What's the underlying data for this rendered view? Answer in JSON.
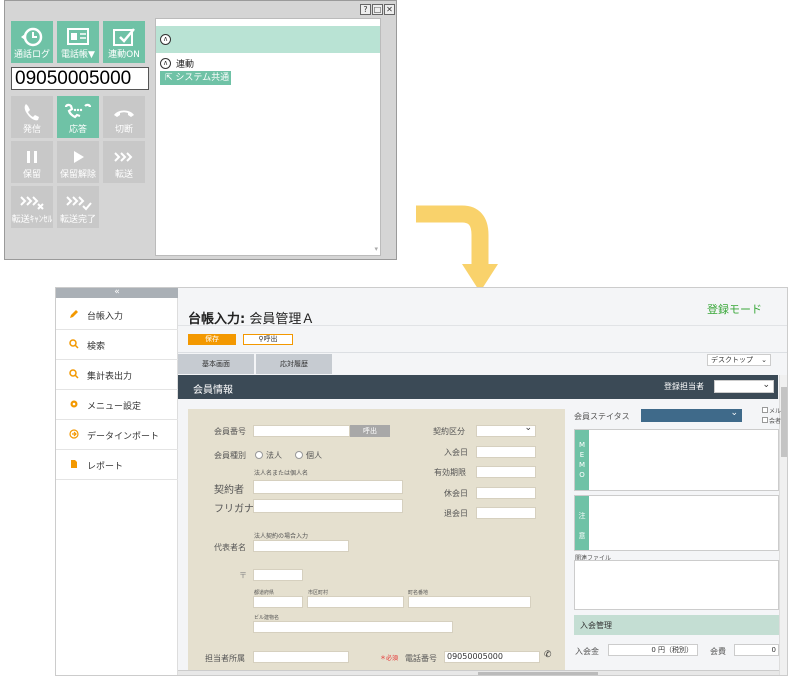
{
  "phone": {
    "window_buttons": [
      "?",
      "□",
      "✕"
    ],
    "top_buttons": [
      {
        "label": "通話ログ",
        "icon": "call-log-icon"
      },
      {
        "label": "電話帳▼",
        "icon": "phonebook-icon"
      },
      {
        "label": "連動ON",
        "icon": "link-on-icon"
      }
    ],
    "number": "09050005000",
    "call_buttons": [
      {
        "label": "発信",
        "icon": "call-icon",
        "enabled": false
      },
      {
        "label": "応答",
        "icon": "answer-icon",
        "enabled": true
      },
      {
        "label": "切断",
        "icon": "hangup-icon",
        "enabled": false
      },
      {
        "label": "保留",
        "icon": "pause-icon",
        "enabled": false
      },
      {
        "label": "保留解除",
        "icon": "play-icon",
        "enabled": false
      },
      {
        "label": "転送",
        "icon": "transfer-icon",
        "enabled": false
      },
      {
        "label": "転送ｷｬﾝｾﾙ",
        "icon": "transfer-cancel-icon",
        "enabled": false
      },
      {
        "label": "転送完了",
        "icon": "transfer-done-icon",
        "enabled": false
      }
    ],
    "link_label": "連動",
    "system_share": "システム共通"
  },
  "app": {
    "collapse": "«",
    "sidebar": [
      {
        "label": "台帳入力",
        "icon": "pencil-icon"
      },
      {
        "label": "検索",
        "icon": "search-icon"
      },
      {
        "label": "集計表出力",
        "icon": "report-search-icon"
      },
      {
        "label": "メニュー設定",
        "icon": "gear-icon"
      },
      {
        "label": "データインポート",
        "icon": "import-icon"
      },
      {
        "label": "レポート",
        "icon": "document-icon"
      }
    ],
    "title_bold": "台帳入力:",
    "title_rest": " 会員管理Ａ",
    "mode": "登録モード",
    "save": "保存",
    "call": "呼出",
    "tabs": [
      "基本画面",
      "応対履歴"
    ],
    "view_select": "デスクトップ",
    "section": "会員情報",
    "registrar_label": "登録担当者",
    "form": {
      "member_no": "会員番号",
      "call_btn": "呼出",
      "member_type": "会員種別",
      "corp": "法人",
      "person": "個人",
      "name_hint": "法人名または個人名",
      "contractor": "契約者",
      "furigana": "フリガナ",
      "rep_hint": "法人契約の場合入力",
      "rep_name": "代表者名",
      "postal": "〒",
      "pref": "都道府県",
      "city": "市区町村",
      "town": "町名番地",
      "building": "ビル建物名",
      "contract_type": "契約区分",
      "join_date": "入会日",
      "valid_until": "有効期限",
      "suspend_date": "休会日",
      "leave_date": "退会日",
      "dept": "担当者所属",
      "required": "＊必須",
      "phone_label": "電話番号",
      "phone_value": "09050005000"
    },
    "right": {
      "status": "会員ステイタス",
      "memo": [
        "M",
        "E",
        "M",
        "O"
      ],
      "note": [
        "注",
        "意"
      ],
      "related": "関連ファイル",
      "check1": "メル",
      "check2": "会者",
      "admission": "入会管理",
      "fee_label": "入会金",
      "fee_value": "0 円（税別）",
      "dues_label": "会費",
      "dues_value": "0"
    }
  },
  "colors": {
    "accent": "#6fc2a6",
    "orange": "#f39800",
    "header": "#3b4a56",
    "form_bg": "#e5e0cf"
  }
}
